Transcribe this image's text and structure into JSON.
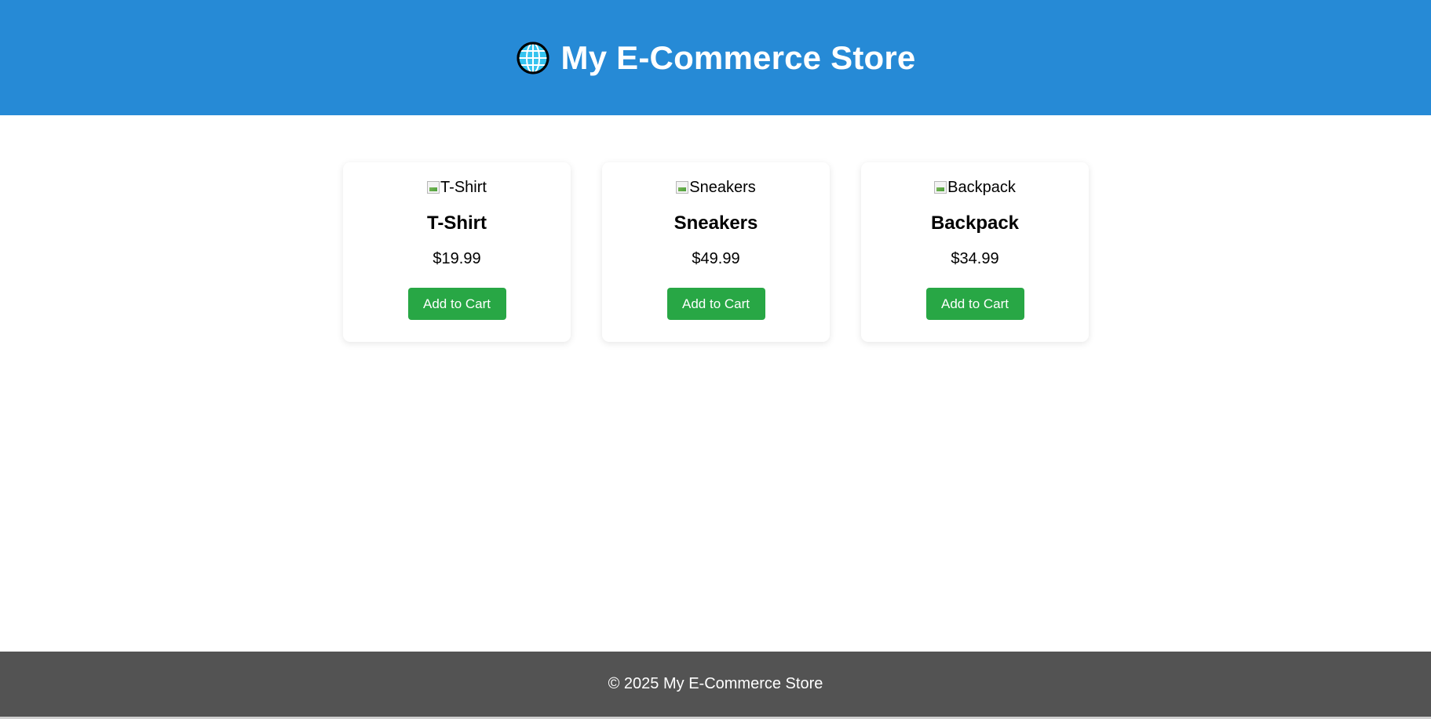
{
  "header": {
    "icon": "globe-icon",
    "title": "My E-Commerce Store",
    "background": "#268ad6"
  },
  "products": [
    {
      "image_alt": "T-Shirt",
      "name": "T-Shirt",
      "price": "$19.99",
      "button_label": "Add to Cart"
    },
    {
      "image_alt": "Sneakers",
      "name": "Sneakers",
      "price": "$49.99",
      "button_label": "Add to Cart"
    },
    {
      "image_alt": "Backpack",
      "name": "Backpack",
      "price": "$34.99",
      "button_label": "Add to Cart"
    }
  ],
  "footer": {
    "text": "© 2025 My E-Commerce Store",
    "background": "#535353"
  },
  "colors": {
    "accent_button": "#28a745"
  }
}
